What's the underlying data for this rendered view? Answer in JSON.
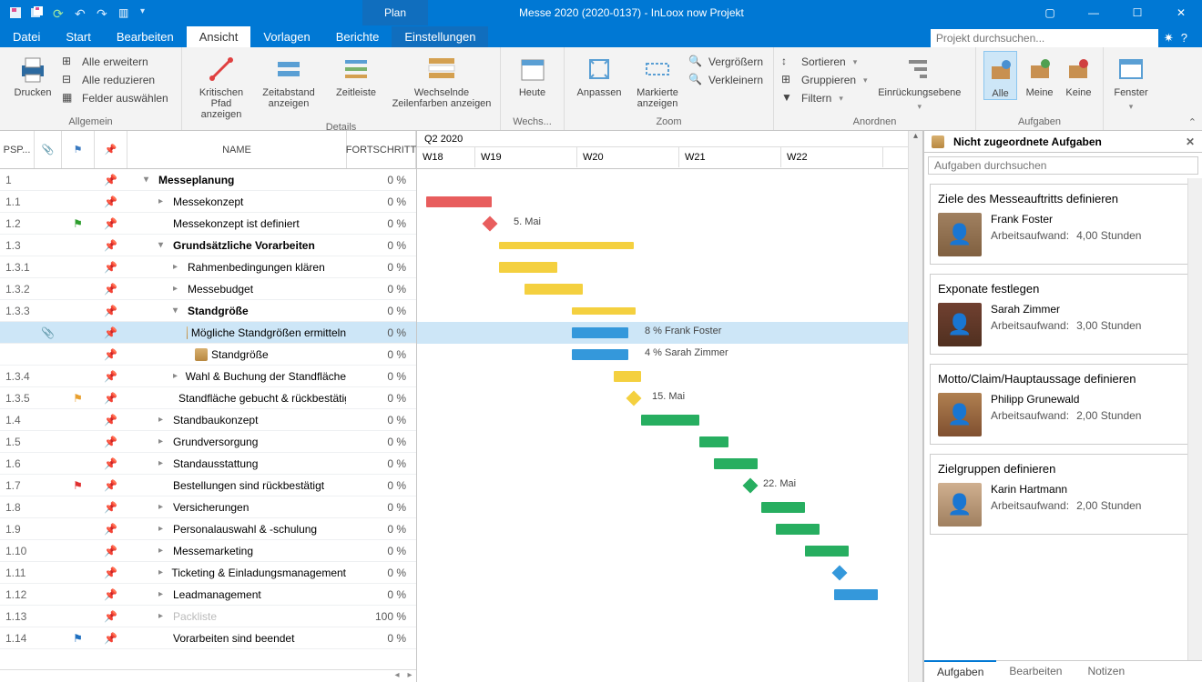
{
  "window": {
    "plan_tab": "Plan",
    "title": "Messe 2020 (2020-0137) - InLoox now Projekt"
  },
  "menu": {
    "datei": "Datei",
    "start": "Start",
    "bearbeiten": "Bearbeiten",
    "ansicht": "Ansicht",
    "vorlagen": "Vorlagen",
    "berichte": "Berichte",
    "einstellungen": "Einstellungen",
    "search_placeholder": "Projekt durchsuchen..."
  },
  "ribbon": {
    "drucken": "Drucken",
    "alle_erweitern": "Alle erweitern",
    "alle_reduzieren": "Alle reduzieren",
    "felder_auswahlen": "Felder auswählen",
    "allgemein": "Allgemein",
    "kritischen_pfad": "Kritischen Pfad anzeigen",
    "zeitabstand": "Zeitabstand anzeigen",
    "zeitleiste": "Zeitleiste",
    "wechselnde": "Wechselnde Zeilenfarben anzeigen",
    "details": "Details",
    "heute": "Heute",
    "wechs": "Wechs...",
    "anpassen": "Anpassen",
    "markierte": "Markierte anzeigen",
    "vergroessern": "Vergrößern",
    "verkleinern": "Verkleinern",
    "zoom": "Zoom",
    "sortieren": "Sortieren",
    "gruppieren": "Gruppieren",
    "filtern": "Filtern",
    "einruckungsebene": "Einrückungsebene",
    "anordnen": "Anordnen",
    "alle": "Alle",
    "meine": "Meine",
    "keine": "Keine",
    "aufgaben": "Aufgaben",
    "fenster": "Fenster"
  },
  "grid": {
    "psp": "PSP...",
    "name": "NAME",
    "fortschritt": "FORTSCHRITT"
  },
  "tasks": [
    {
      "psp": "1",
      "name": "Messeplanung",
      "prog": "0 %",
      "bold": true,
      "toggle": "▾",
      "indent": 1
    },
    {
      "psp": "1.1",
      "name": "Messekonzept",
      "prog": "0 %",
      "toggle": "▸",
      "indent": 2
    },
    {
      "psp": "1.2",
      "name": "Messekonzept ist definiert",
      "prog": "0 %",
      "indent": 2,
      "flag": "green"
    },
    {
      "psp": "1.3",
      "name": "Grundsätzliche Vorarbeiten",
      "prog": "0 %",
      "bold": true,
      "toggle": "▾",
      "indent": 2
    },
    {
      "psp": "1.3.1",
      "name": "Rahmenbedingungen klären",
      "prog": "0 %",
      "toggle": "▸",
      "indent": 3
    },
    {
      "psp": "1.3.2",
      "name": "Messebudget",
      "prog": "0 %",
      "toggle": "▸",
      "indent": 3
    },
    {
      "psp": "1.3.3",
      "name": "Standgröße",
      "prog": "0 %",
      "bold": true,
      "toggle": "▾",
      "indent": 3
    },
    {
      "psp": "",
      "name": "Mögliche Standgrößen ermitteln",
      "prog": "0 %",
      "indent": 4,
      "box": true,
      "selected": true,
      "clip": true
    },
    {
      "psp": "",
      "name": "Standgröße",
      "prog": "0 %",
      "indent": 4,
      "box": true
    },
    {
      "psp": "1.3.4",
      "name": "Wahl & Buchung der Standfläche",
      "prog": "0 %",
      "toggle": "▸",
      "indent": 3
    },
    {
      "psp": "1.3.5",
      "name": "Standfläche gebucht & rückbestätigt",
      "prog": "0 %",
      "indent": 3,
      "flag": "orange"
    },
    {
      "psp": "1.4",
      "name": "Standbaukonzept",
      "prog": "0 %",
      "toggle": "▸",
      "indent": 2
    },
    {
      "psp": "1.5",
      "name": "Grundversorgung",
      "prog": "0 %",
      "toggle": "▸",
      "indent": 2
    },
    {
      "psp": "1.6",
      "name": "Standausstattung",
      "prog": "0 %",
      "toggle": "▸",
      "indent": 2
    },
    {
      "psp": "1.7",
      "name": "Bestellungen sind rückbestätigt",
      "prog": "0 %",
      "indent": 2,
      "flag": "red"
    },
    {
      "psp": "1.8",
      "name": "Versicherungen",
      "prog": "0 %",
      "toggle": "▸",
      "indent": 2
    },
    {
      "psp": "1.9",
      "name": "Personalauswahl & -schulung",
      "prog": "0 %",
      "toggle": "▸",
      "indent": 2
    },
    {
      "psp": "1.10",
      "name": "Messemarketing",
      "prog": "0 %",
      "toggle": "▸",
      "indent": 2
    },
    {
      "psp": "1.11",
      "name": "Ticketing & Einladungsmanagement",
      "prog": "0 %",
      "toggle": "▸",
      "indent": 2
    },
    {
      "psp": "1.12",
      "name": "Leadmanagement",
      "prog": "0 %",
      "toggle": "▸",
      "indent": 2
    },
    {
      "psp": "1.13",
      "name": "Packliste",
      "prog": "100 %",
      "toggle": "▸",
      "indent": 2,
      "dim": true
    },
    {
      "psp": "1.14",
      "name": "Vorarbeiten sind beendet",
      "prog": "0 %",
      "indent": 2,
      "flag": "blue"
    }
  ],
  "gantt": {
    "quarter": "Q2 2020",
    "weeks": [
      "W18",
      "W19",
      "W20",
      "W21",
      "W22"
    ],
    "labels": {
      "d5mai": "5. Mai",
      "ff": "8 % Frank Foster",
      "sz": "4 % Sarah Zimmer",
      "d15mai": "15. Mai",
      "d22mai": "22. Mai"
    }
  },
  "panel": {
    "header": "Nicht zugeordnete Aufgaben",
    "search_placeholder": "Aufgaben durchsuchen",
    "effort_label": "Arbeitsaufwand:",
    "cards": [
      {
        "title": "Ziele des Messeauftritts definieren",
        "name": "Frank Foster",
        "effort": "4,00 Stunden"
      },
      {
        "title": "Exponate festlegen",
        "name": "Sarah Zimmer",
        "effort": "3,00 Stunden"
      },
      {
        "title": "Motto/Claim/Hauptaussage definieren",
        "name": "Philipp Grunewald",
        "effort": "2,00 Stunden"
      },
      {
        "title": "Zielgruppen definieren",
        "name": "Karin Hartmann",
        "effort": "2,00 Stunden"
      }
    ],
    "tabs": {
      "aufgaben": "Aufgaben",
      "bearbeiten": "Bearbeiten",
      "notizen": "Notizen"
    }
  }
}
